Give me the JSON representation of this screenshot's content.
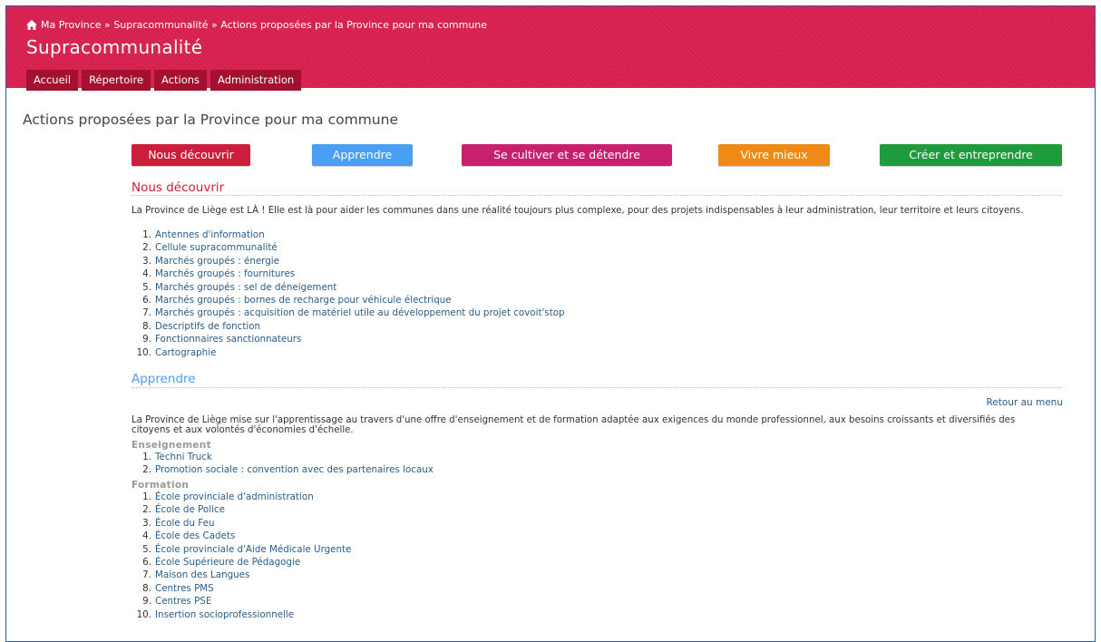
{
  "breadcrumb": "Ma Province » Supracommunalité » Actions proposées par la Province pour ma commune",
  "site_title": "Supracommunalité",
  "nav": [
    "Accueil",
    "Répertoire",
    "Actions",
    "Administration"
  ],
  "page_title": "Actions proposées par la Province pour ma commune",
  "categories": [
    {
      "label": "Nous découvrir",
      "color": "#cc1e3a"
    },
    {
      "label": "Apprendre",
      "color": "#4a9ff5"
    },
    {
      "label": "Se cultiver et se détendre",
      "color": "#c8206e"
    },
    {
      "label": "Vivre mieux",
      "color": "#ef8a17"
    },
    {
      "label": "Créer et entreprendre",
      "color": "#1f9a3c"
    }
  ],
  "section1": {
    "title": "Nous découvrir",
    "intro": "La Province de Liège est LÀ ! Elle est là pour aider les communes dans une réalité toujours plus complexe, pour des projets indispensables à leur administration, leur territoire et leurs citoyens.",
    "items": [
      "Antennes d'information",
      "Cellule supracommunalité",
      "Marchés groupés : énergie",
      "Marchés groupés : fournitures",
      "Marchés groupés : sel de déneigement",
      "Marchés groupés : bornes de recharge pour véhicule électrique",
      "Marchés groupés : acquisition de matériel utile au développement du projet covoit'stop",
      "Descriptifs de fonction",
      "Fonctionnaires sanctionnateurs",
      "Cartographie"
    ]
  },
  "section2": {
    "title": "Apprendre",
    "back_link": "Retour au menu",
    "intro": "La Province de Liège mise sur l'apprentissage au travers d'une offre d'enseignement et de formation adaptée aux exigences du monde professionnel, aux besoins croissants et diversifiés des citoyens et aux volontés d'économies d'échelle.",
    "sub1": "Enseignement",
    "sub1_items": [
      "Techni Truck",
      "Promotion sociale : convention avec des partenaires locaux"
    ],
    "sub2": "Formation",
    "sub2_items": [
      "École provinciale d'administration",
      "École de Police",
      "École du Feu",
      "École des Cadets",
      "École provinciale d'Aide Médicale Urgente",
      "École Supérieure de Pédagogie",
      "Maison des Langues",
      "Centres PMS",
      "Centres PSE",
      "Insertion socioprofessionnelle"
    ]
  }
}
